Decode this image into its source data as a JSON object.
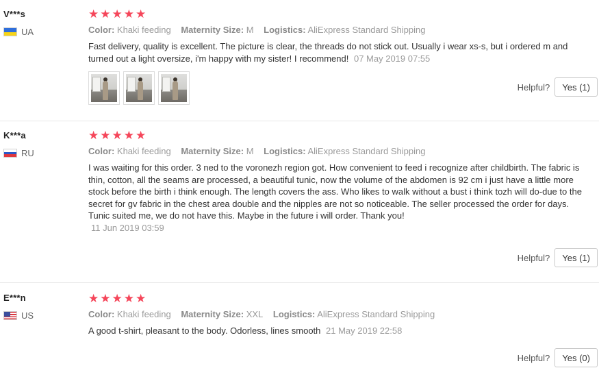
{
  "reviews": [
    {
      "user": "V***s",
      "country": "UA",
      "stars": "★★★★★",
      "rating": 5,
      "color_label": "Color:",
      "color": "Khaki feeding",
      "size_label": "Maternity Size:",
      "size": "M",
      "logistics_label": "Logistics:",
      "logistics": "AliExpress Standard Shipping",
      "text": "Fast delivery, quality is excellent. The picture is clear, the threads do not stick out. Usually i wear xs-s, but i ordered m and turned out a light oversize, i'm happy with my sister! I recommend!",
      "date": "07 May 2019 07:55",
      "helpful_label": "Helpful?",
      "yes_label": "Yes (1)"
    },
    {
      "user": "K***a",
      "country": "RU",
      "stars": "★★★★★",
      "rating": 5,
      "color_label": "Color:",
      "color": "Khaki feeding",
      "size_label": "Maternity Size:",
      "size": "M",
      "logistics_label": "Logistics:",
      "logistics": "AliExpress Standard Shipping",
      "text": "I was waiting for this order. 3 ned to the voronezh region got. How convenient to feed i recognize after childbirth. The fabric is thin, cotton, all the seams are processed, a beautiful tunic, now the volume of the abdomen is 92 cm i just have a little more stock before the birth i think enough. The length covers the ass. Who likes to walk without a bust i think tozh will do-due to the secret for gv fabric in the chest area double and the nipples are not so noticeable. The seller processed the order for days. Tunic suited me, we do not have this. Maybe in the future i will order. Thank you!",
      "date": "11 Jun 2019 03:59",
      "helpful_label": "Helpful?",
      "yes_label": "Yes (1)"
    },
    {
      "user": "E***n",
      "country": "US",
      "stars": "★★★★★",
      "rating": 5,
      "color_label": "Color:",
      "color": "Khaki feeding",
      "size_label": "Maternity Size:",
      "size": "XXL",
      "logistics_label": "Logistics:",
      "logistics": "AliExpress Standard Shipping",
      "text": "A good t-shirt, pleasant to the body. Odorless, lines smooth",
      "date": "21 May 2019 22:58",
      "helpful_label": "Helpful?",
      "yes_label": "Yes (0)"
    }
  ],
  "colors": {
    "star": "#f5465a",
    "muted": "#9a9a9a",
    "divider": "#e8e8e8"
  }
}
